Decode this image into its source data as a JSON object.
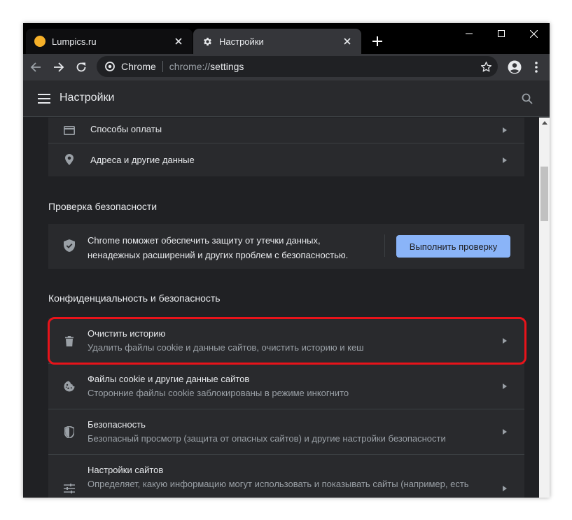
{
  "tabs": [
    {
      "title": "Lumpics.ru",
      "favicon": "orange-circle",
      "active": false
    },
    {
      "title": "Настройки",
      "favicon": "gear-icon",
      "active": true
    }
  ],
  "toolbar": {
    "site_name": "Chrome",
    "url_host": "chrome://",
    "url_path": "settings"
  },
  "header": {
    "title": "Настройки"
  },
  "autofill": {
    "items": [
      {
        "label": "Способы оплаты",
        "icon": "credit-card-icon"
      },
      {
        "label": "Адреса и другие данные",
        "icon": "location-pin-icon"
      }
    ]
  },
  "safety_check": {
    "section_title": "Проверка безопасности",
    "line1": "Chrome поможет обеспечить защиту от утечки данных,",
    "line2": "ненадежных расширений и других проблем с безопасностью.",
    "button_label": "Выполнить проверку"
  },
  "privacy": {
    "section_title": "Конфиденциальность и безопасность",
    "items": [
      {
        "title": "Очистить историю",
        "subtitle": "Удалить файлы cookie и данные сайтов, очистить историю и кеш",
        "icon": "trash-icon",
        "highlighted": true
      },
      {
        "title": "Файлы cookie и другие данные сайтов",
        "subtitle": "Сторонние файлы cookie заблокированы в режиме инкогнито",
        "icon": "cookie-icon"
      },
      {
        "title": "Безопасность",
        "subtitle": "Безопасный просмотр (защита от опасных сайтов) и другие настройки безопасности",
        "icon": "shield-icon"
      },
      {
        "title": "Настройки сайтов",
        "subtitle": "Определяет, какую информацию могут использовать и показывать сайты (например, есть",
        "icon": "sliders-icon"
      }
    ]
  },
  "colors": {
    "accent_button": "#8ab4f8",
    "highlight_border": "#e8131a",
    "background": "#202124",
    "card": "#292a2d"
  }
}
